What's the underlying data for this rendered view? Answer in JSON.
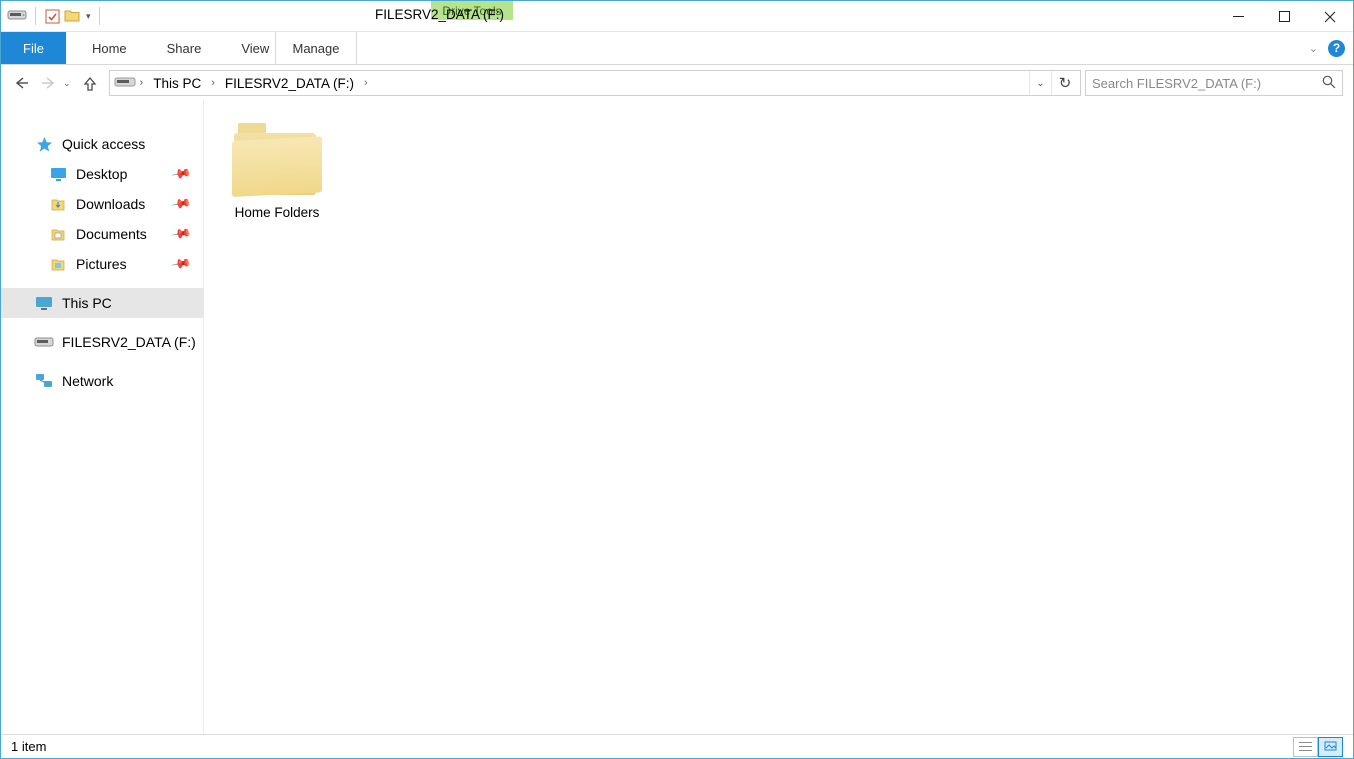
{
  "titlebar": {
    "context_tab": "Drive Tools",
    "title": "FILESRV2_DATA (F:)"
  },
  "ribbon": {
    "file": "File",
    "home": "Home",
    "share": "Share",
    "view": "View",
    "manage": "Manage"
  },
  "address": {
    "crumb1": "This PC",
    "crumb2": "FILESRV2_DATA (F:)"
  },
  "search": {
    "placeholder": "Search FILESRV2_DATA (F:)"
  },
  "nav": {
    "quick_access": "Quick access",
    "desktop": "Desktop",
    "downloads": "Downloads",
    "documents": "Documents",
    "pictures": "Pictures",
    "this_pc": "This PC",
    "drive": "FILESRV2_DATA (F:)",
    "network": "Network"
  },
  "content": {
    "item1": "Home Folders"
  },
  "status": {
    "count": "1 item"
  }
}
